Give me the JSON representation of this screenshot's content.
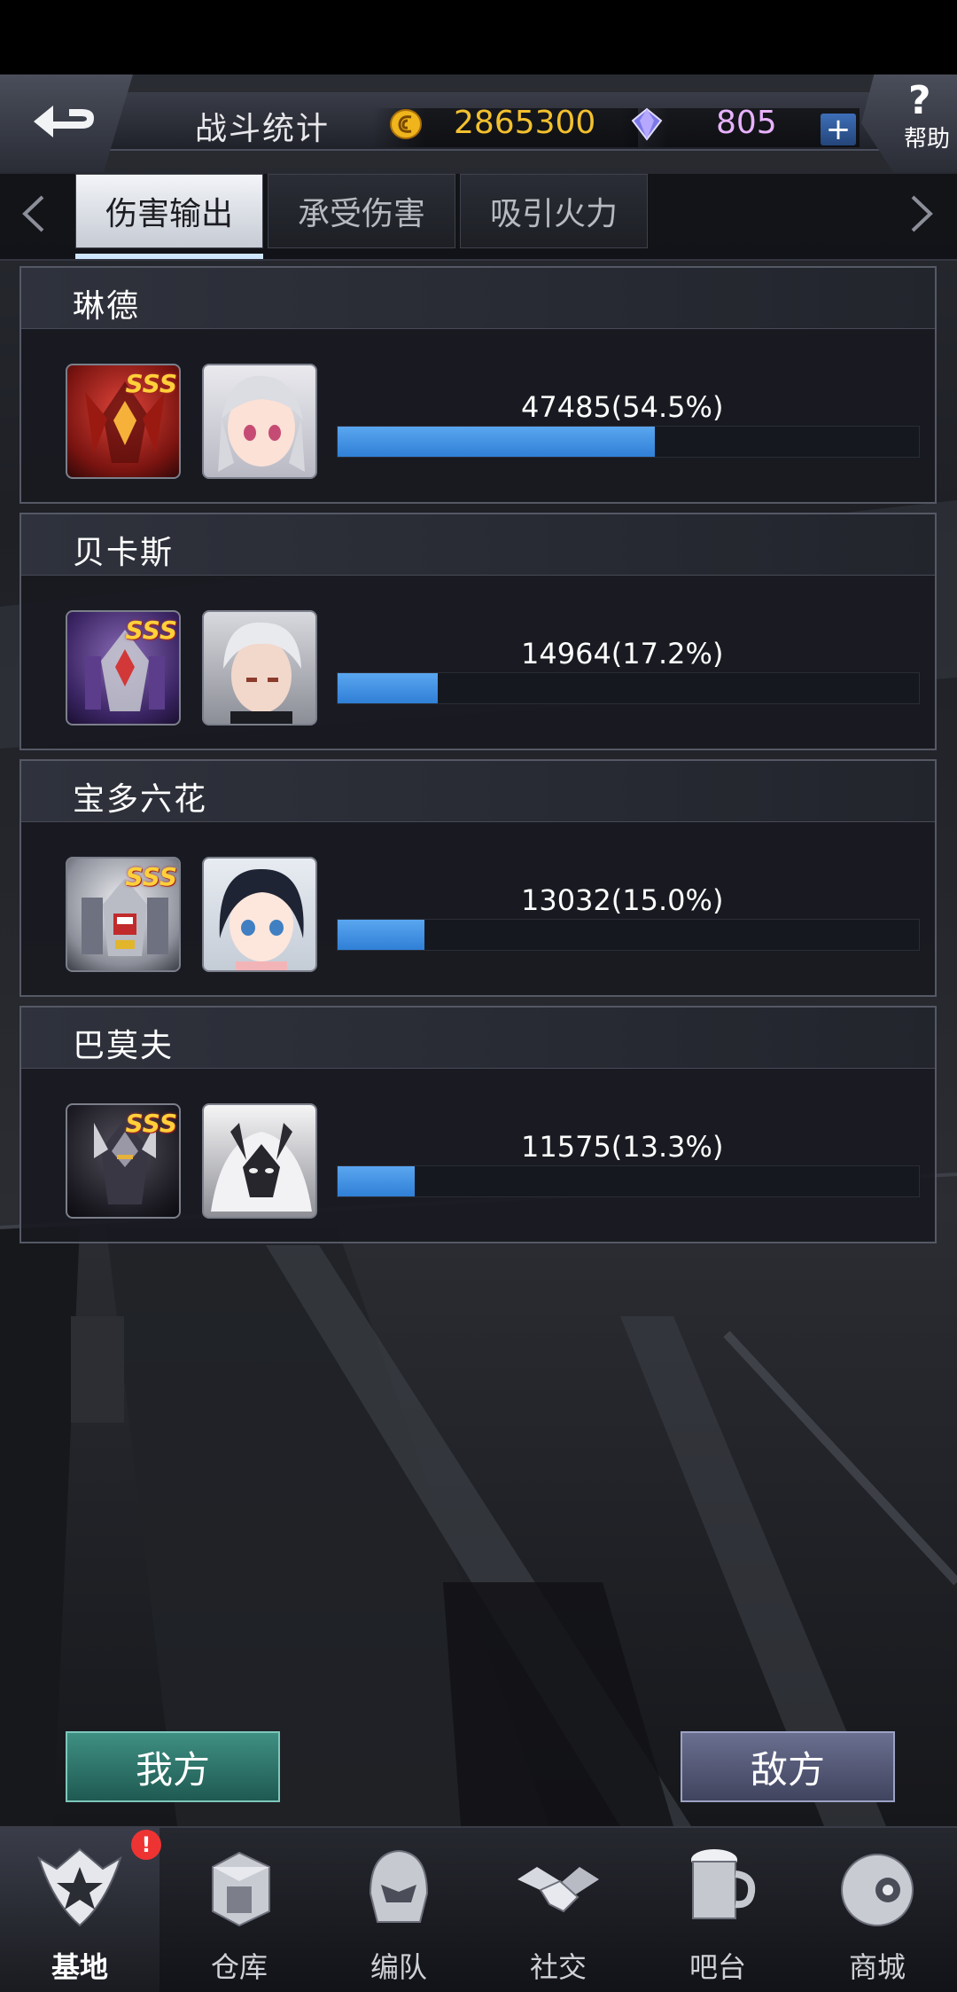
{
  "header": {
    "title": "战斗统计",
    "gold": "2865300",
    "gems": "805",
    "plus_label": "+",
    "help_label": "帮助",
    "help_symbol": "?"
  },
  "tabs": [
    {
      "label": "伤害输出",
      "active": true
    },
    {
      "label": "承受伤害",
      "active": false
    },
    {
      "label": "吸引火力",
      "active": false
    }
  ],
  "players": [
    {
      "name": "琳德",
      "damage_text": "47485(54.5%)",
      "percent": 54.5,
      "rank": "SSS",
      "mech_color": "#b3201c",
      "pilot_hair": "#d9d9de"
    },
    {
      "name": "贝卡斯",
      "damage_text": "14964(17.2%)",
      "percent": 17.2,
      "rank": "SSS",
      "mech_color": "#5a3c86",
      "pilot_hair": "#d0d2d8"
    },
    {
      "name": "宝多六花",
      "damage_text": "13032(15.0%)",
      "percent": 15.0,
      "rank": "SSS",
      "mech_color": "#c9cbd2",
      "pilot_hair": "#1e2230"
    },
    {
      "name": "巴莫夫",
      "damage_text": "11575(13.3%)",
      "percent": 13.3,
      "rank": "SSS",
      "mech_color": "#2a2830",
      "pilot_hair": "#efefef"
    }
  ],
  "buttons": {
    "mine": "我方",
    "enemy": "敌方"
  },
  "nav": [
    {
      "label": "基地",
      "icon": "base-emblem-icon",
      "active": true,
      "badge": "!"
    },
    {
      "label": "仓库",
      "icon": "warehouse-icon",
      "active": false
    },
    {
      "label": "编队",
      "icon": "formation-helmet-icon",
      "active": false
    },
    {
      "label": "社交",
      "icon": "handshake-icon",
      "active": false
    },
    {
      "label": "吧台",
      "icon": "beer-mug-icon",
      "active": false
    },
    {
      "label": "商城",
      "icon": "shop-robot-icon",
      "active": false
    }
  ],
  "colors": {
    "gold": "#f3c12e",
    "gem": "#e8b2ff",
    "bar": "#3a8ae0",
    "mine_button": "#2f766c",
    "enemy_button": "#555a78"
  }
}
